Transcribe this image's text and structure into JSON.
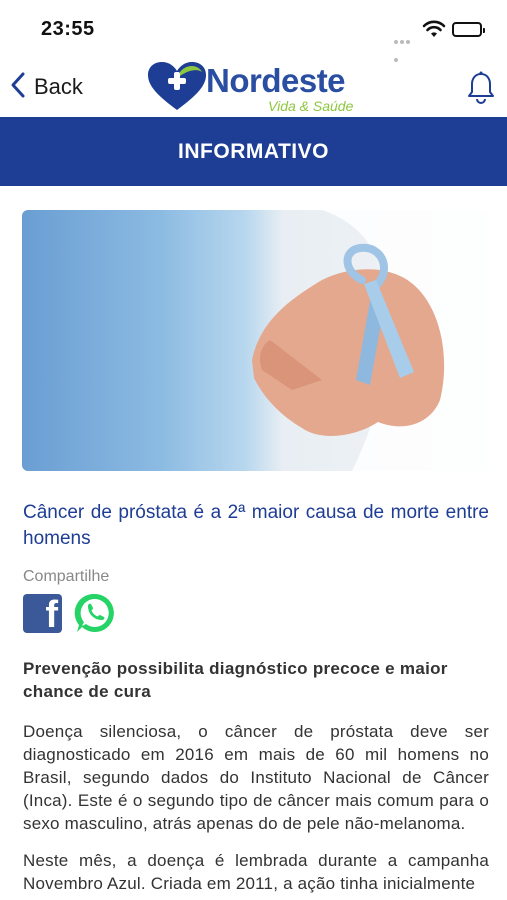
{
  "status_bar": {
    "time": "23:55"
  },
  "nav": {
    "back_label": "Back",
    "logo_text": "Nordeste",
    "logo_tagline": "Vida & Saúde"
  },
  "banner": {
    "title": "INFORMATIVO"
  },
  "article": {
    "title": "Câncer de próstata é a 2ª maior causa de morte entre homens",
    "share_label": "Compartilhe",
    "subtitle": "Prevenção possibilita diagnóstico precoce e maior chance de cura",
    "paragraphs": [
      "Doença silenciosa, o câncer de próstata deve ser diagnosticado em 2016 em mais de 60 mil homens no Brasil, segundo dados do Instituto Nacional de Câncer (Inca). Este é o segundo tipo de câncer mais comum para o sexo masculino, atrás apenas do de pele não-melanoma.",
      "Neste mês, a doença é lembrada durante a campanha Novembro Azul. Criada em 2011, a ação tinha inicialmente"
    ]
  },
  "colors": {
    "brand_blue": "#1e3d94",
    "brand_green": "#8dc63f",
    "facebook": "#3b5998",
    "whatsapp": "#25d366"
  }
}
